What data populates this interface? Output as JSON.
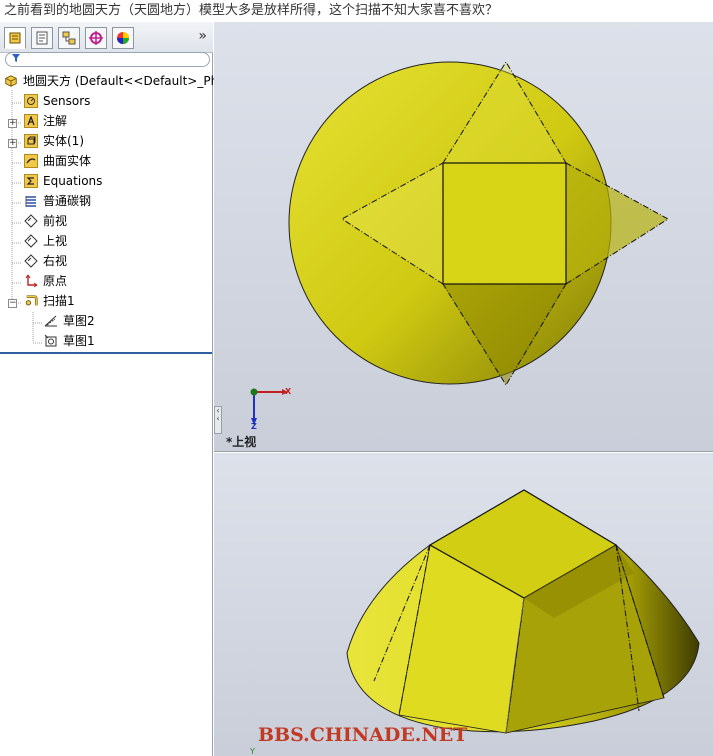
{
  "post": {
    "caption": "之前看到的地圆天方（天圆地方）模型大多是放样所得，这个扫描不知大家喜不喜欢？"
  },
  "feature_manager": {
    "tabs": [
      {
        "icon": "feature-tree-icon"
      },
      {
        "icon": "property-manager-icon"
      },
      {
        "icon": "configuration-manager-icon"
      },
      {
        "icon": "dimxpert-icon"
      },
      {
        "icon": "display-manager-icon"
      }
    ],
    "more_label": "»",
    "filter_icon": "filter-icon",
    "tree": [
      {
        "label": "地圆天方  (Default<<Default>_Ph",
        "icon": "part-icon"
      },
      {
        "label": "Sensors",
        "icon": "sensors-icon"
      },
      {
        "label": "注解",
        "icon": "annotations-icon",
        "expandable": true
      },
      {
        "label": "实体(1)",
        "icon": "solid-bodies-icon",
        "expandable": true
      },
      {
        "label": "曲面实体",
        "icon": "surface-bodies-icon"
      },
      {
        "label": "Equations",
        "icon": "equations-icon"
      },
      {
        "label": "普通碳钢",
        "icon": "material-icon"
      },
      {
        "label": "前视",
        "icon": "plane-icon"
      },
      {
        "label": "上视",
        "icon": "plane-icon"
      },
      {
        "label": "右视",
        "icon": "plane-icon"
      },
      {
        "label": "原点",
        "icon": "origin-icon"
      },
      {
        "label": "扫描1",
        "icon": "sweep-icon",
        "expandable": true,
        "expanded": true
      },
      {
        "label": "草图2",
        "icon": "sketch-icon"
      },
      {
        "label": "草图1",
        "icon": "sketch-icon"
      }
    ]
  },
  "viewport": {
    "top_view_label": "*上视",
    "triad": {
      "x": "X",
      "z": "Z",
      "y": "Y"
    },
    "watermark": "BBS.CHINADE.NET"
  },
  "colors": {
    "model_yellow": "#d8d416",
    "model_dark": "#8c8600",
    "view_background": "#d4d8e1",
    "watermark": "#c23a24",
    "selection_line": "#2f5f9f"
  }
}
